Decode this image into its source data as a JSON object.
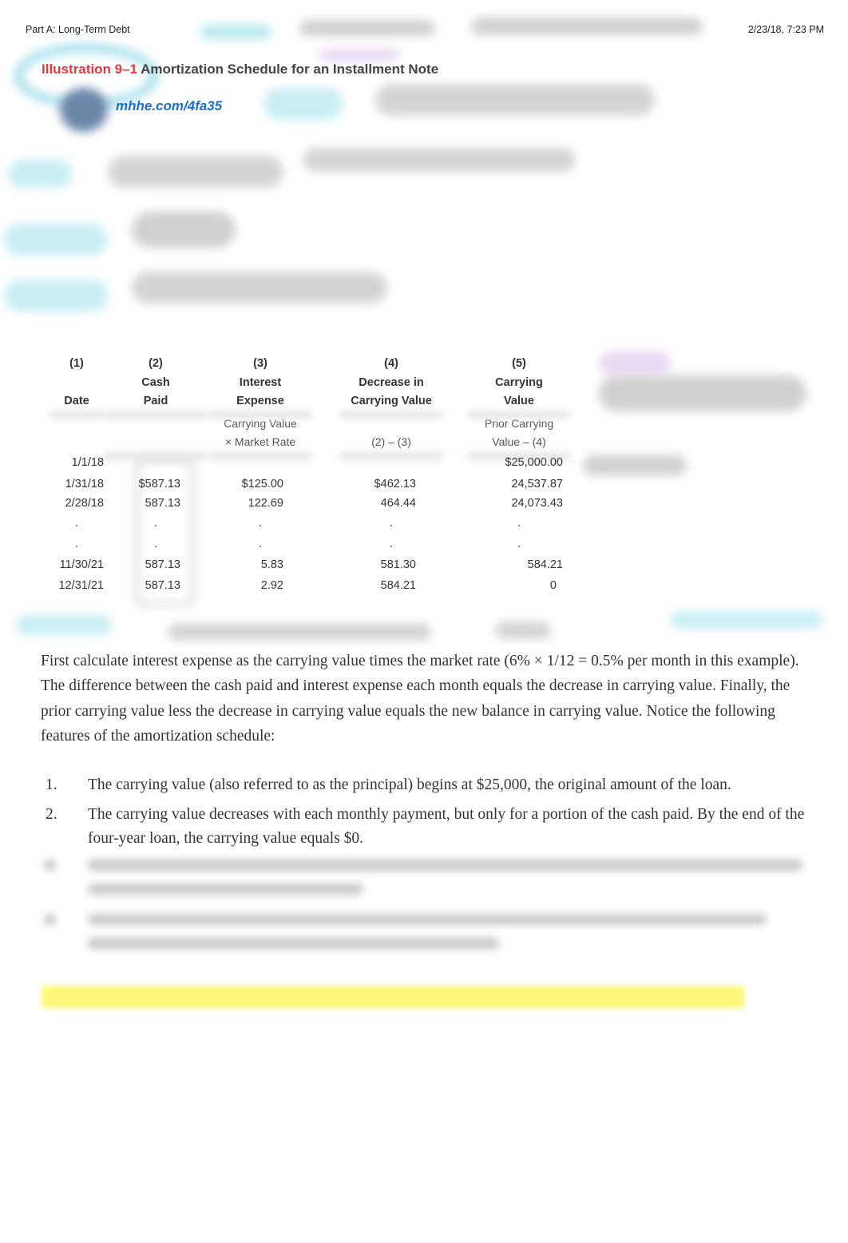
{
  "header": {
    "section": "Part A: Long-Term Debt",
    "timestamp": "2/23/18, 7:23 PM"
  },
  "illustration": {
    "number": "Illustration 9–1",
    "title": "Amortization Schedule for an Installment Note",
    "link": "mhhe.com/4fa35"
  },
  "table": {
    "columns": [
      {
        "num": "(1)",
        "line1": "",
        "line2": "Date",
        "formula1": "",
        "formula2": ""
      },
      {
        "num": "(2)",
        "line1": "Cash",
        "line2": "Paid",
        "formula1": "",
        "formula2": ""
      },
      {
        "num": "(3)",
        "line1": "Interest",
        "line2": "Expense",
        "formula1": "Carrying Value",
        "formula2": "× Market Rate"
      },
      {
        "num": "(4)",
        "line1": "Decrease in",
        "line2": "Carrying Value",
        "formula1": "",
        "formula2": "(2) – (3)"
      },
      {
        "num": "(5)",
        "line1": "Carrying",
        "line2": "Value",
        "formula1": "Prior Carrying",
        "formula2": "Value – (4)"
      }
    ],
    "rows": [
      {
        "date": "1/1/18",
        "cash": "",
        "interest": "",
        "decrease": "",
        "carrying": "$25,000.00"
      },
      {
        "date": "1/31/18",
        "cash": "$587.13",
        "interest": "$125.00",
        "decrease": "$462.13",
        "carrying": "24,537.87"
      },
      {
        "date": "2/28/18",
        "cash": "587.13",
        "interest": "122.69",
        "decrease": "464.44",
        "carrying": "24,073.43"
      },
      {
        "date": "·",
        "cash": "·",
        "interest": "·",
        "decrease": "·",
        "carrying": "·"
      },
      {
        "date": "·",
        "cash": "·",
        "interest": "·",
        "decrease": "·",
        "carrying": "·"
      },
      {
        "date": "11/30/21",
        "cash": "587.13",
        "interest": "5.83",
        "decrease": "581.30",
        "carrying": "584.21"
      },
      {
        "date": "12/31/21",
        "cash": "587.13",
        "interest": "2.92",
        "decrease": "584.21",
        "carrying": "0"
      }
    ]
  },
  "paragraph": "First calculate interest expense as the carrying value times the market rate (6% × 1/12 = 0.5% per month in this example). The difference between the cash paid and interest expense each month equals the decrease in carrying value. Finally, the prior carrying value less the decrease in carrying value equals the new balance in carrying value. Notice the following features of the amortization schedule:",
  "list": [
    {
      "num": "1.",
      "text": "The carrying value (also referred to as the principal) begins at $25,000, the original amount of the loan."
    },
    {
      "num": "2.",
      "text": "The carrying value decreases with each monthly payment, but only for a portion of the cash paid. By the end of the four-year loan, the carrying value equals $0."
    }
  ],
  "colors": {
    "accent_red": "#e8383d",
    "link_blue": "#1a6fd1",
    "highlight": "#fbf77a"
  }
}
